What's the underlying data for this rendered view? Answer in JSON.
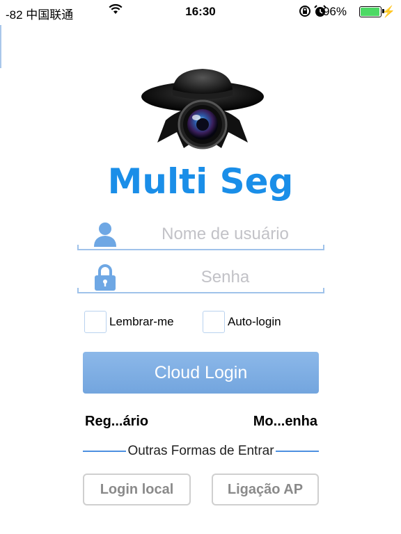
{
  "status_bar": {
    "signal": "-82 中国联通",
    "time": "16:30",
    "battery": "96%",
    "battery_level": 0.96
  },
  "app": {
    "title": "Multi Seg"
  },
  "form": {
    "username_placeholder": "Nome de usuário",
    "username_value": "",
    "password_placeholder": "Senha",
    "password_value": ""
  },
  "options": {
    "remember_label": "Lembrar-me",
    "remember_checked": false,
    "autologin_label": "Auto-login",
    "autologin_checked": false
  },
  "buttons": {
    "cloud_login": "Cloud Login",
    "register": "Reg...ário",
    "forgot_password": "Mo...enha",
    "local_login": "Login local",
    "ap_connect": "Ligação AP"
  },
  "divider": {
    "label": "Outras Formas de Entrar"
  },
  "colors": {
    "accent": "#1a8ee8",
    "button": "#7eaee4",
    "field_line": "#9fc2ea"
  },
  "icons": {
    "username": "user-icon",
    "password": "lock-icon",
    "logo": "spy-camera-logo"
  }
}
